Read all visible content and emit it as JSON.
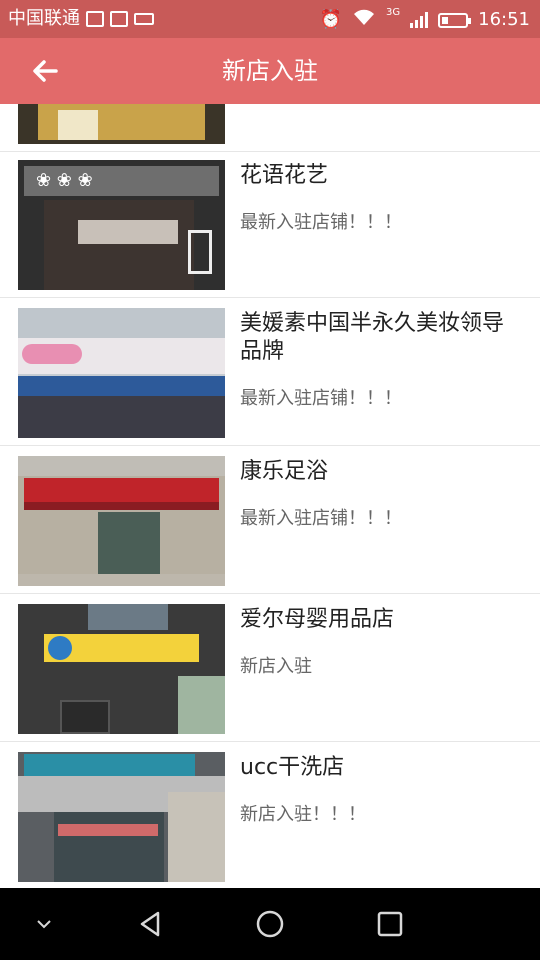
{
  "statusbar": {
    "carrier": "中国联通",
    "network": "3G",
    "time": "16:51",
    "battery_percent": 20
  },
  "appbar": {
    "title": "新店入驻"
  },
  "stores": [
    {
      "name": "花语花艺",
      "desc": "最新入驻店铺！！！"
    },
    {
      "name": "美媛素中国半永久美妆领导品牌",
      "desc": "最新入驻店铺！！！"
    },
    {
      "name": "康乐足浴",
      "desc": "最新入驻店铺！！！"
    },
    {
      "name": "爱尔母婴用品店",
      "desc": "新店入驻"
    },
    {
      "name": "ucc干洗店",
      "desc": "新店入驻！！！"
    }
  ],
  "colors": {
    "status_bg": "#c85a58",
    "appbar_bg": "#e26a6a"
  }
}
